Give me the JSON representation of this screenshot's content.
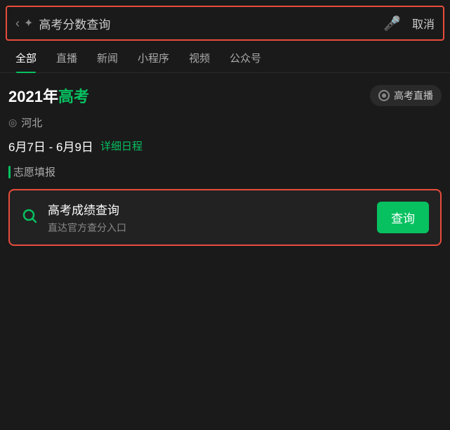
{
  "header": {
    "search_text": "高考分数查询",
    "cancel_label": "取消"
  },
  "tabs": [
    {
      "id": "all",
      "label": "全部",
      "active": true
    },
    {
      "id": "live",
      "label": "直播",
      "active": false
    },
    {
      "id": "news",
      "label": "新闻",
      "active": false
    },
    {
      "id": "miniapp",
      "label": "小程序",
      "active": false
    },
    {
      "id": "video",
      "label": "视频",
      "active": false
    },
    {
      "id": "official",
      "label": "公众号",
      "active": false
    }
  ],
  "gaokao_card": {
    "title_prefix": "2021年",
    "title_highlight": "高考",
    "live_label": "高考直播",
    "location": "河北",
    "date_range": "6月7日 - 6月9日",
    "date_detail_link": "详细日程",
    "volunteer_label": "志愿填报"
  },
  "score_query": {
    "title": "高考成绩查询",
    "subtitle": "直达官方查分入口",
    "button_label": "查询"
  },
  "colors": {
    "accent": "#07c160",
    "highlight_border": "#e74c3c",
    "bg_dark": "#1a1a1a"
  }
}
